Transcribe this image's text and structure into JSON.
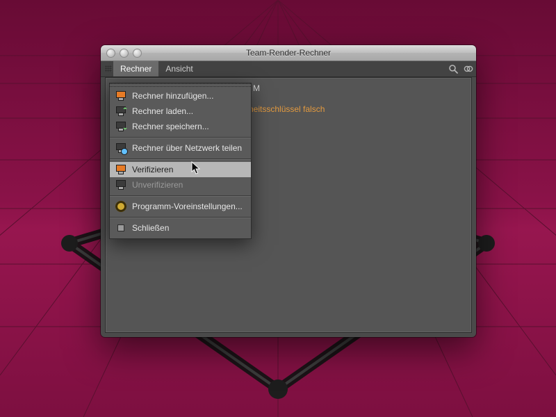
{
  "window": {
    "title": "Team-Render-Rechner"
  },
  "menubar": {
    "items": [
      "Rechner",
      "Ansicht"
    ],
    "active_index": 0,
    "tools": {
      "search": "search-icon",
      "overflow": "overflow-icon"
    }
  },
  "client_list": {
    "row0": {
      "checked": true,
      "label_suffix": "M"
    },
    "row1": {
      "status_suffix": "heitsschlüssel falsch"
    }
  },
  "menu_rechner": {
    "items": [
      {
        "icon": "monitor-add-icon",
        "label": "Rechner hinzufügen..."
      },
      {
        "icon": "monitor-load-icon",
        "label": "Rechner laden..."
      },
      {
        "icon": "monitor-save-icon",
        "label": "Rechner speichern..."
      }
    ],
    "share": {
      "icon": "monitor-network-icon",
      "label": "Rechner über Netzwerk teilen"
    },
    "verify": {
      "icon": "monitor-verify-icon",
      "label": "Verifizieren"
    },
    "unverify": {
      "icon": "monitor-unverify-icon",
      "label": "Unverifizieren"
    },
    "prefs": {
      "icon": "gear-icon",
      "label": "Programm-Voreinstellungen..."
    },
    "close": {
      "icon": "stop-icon",
      "label": "Schließen"
    }
  },
  "colors": {
    "accent_orange": "#e77b25",
    "warn_text": "#e39a3f",
    "panel": "#555555",
    "highlight": "#b7b7b7"
  }
}
